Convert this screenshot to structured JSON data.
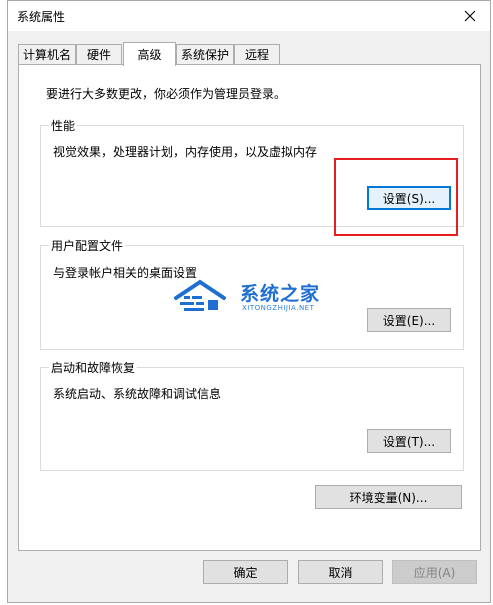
{
  "window": {
    "title": "系统属性",
    "tabs": [
      {
        "label": "计算机名"
      },
      {
        "label": "硬件"
      },
      {
        "label": "高级"
      },
      {
        "label": "系统保护"
      },
      {
        "label": "远程"
      }
    ],
    "active_tab": "高级"
  },
  "panel": {
    "admin_note": "要进行大多数更改，你必须作为管理员登录。",
    "performance": {
      "title": "性能",
      "desc": "视觉效果，处理器计划，内存使用，以及虚拟内存",
      "button": "设置(S)..."
    },
    "user_profiles": {
      "title": "用户配置文件",
      "desc": "与登录帐户相关的桌面设置",
      "button": "设置(E)..."
    },
    "startup_recovery": {
      "title": "启动和故障恢复",
      "desc": "系统启动、系统故障和调试信息",
      "button": "设置(T)..."
    },
    "env_button": "环境变量(N)..."
  },
  "footer": {
    "ok": "确定",
    "cancel": "取消",
    "apply": "应用(A)"
  },
  "watermark": {
    "title": "系统之家",
    "subtitle": "XITONGZHIJIA.NET"
  },
  "colors": {
    "highlight": "#e61e1e",
    "focus": "#0078d7",
    "watermark": "#1e6fd1"
  }
}
